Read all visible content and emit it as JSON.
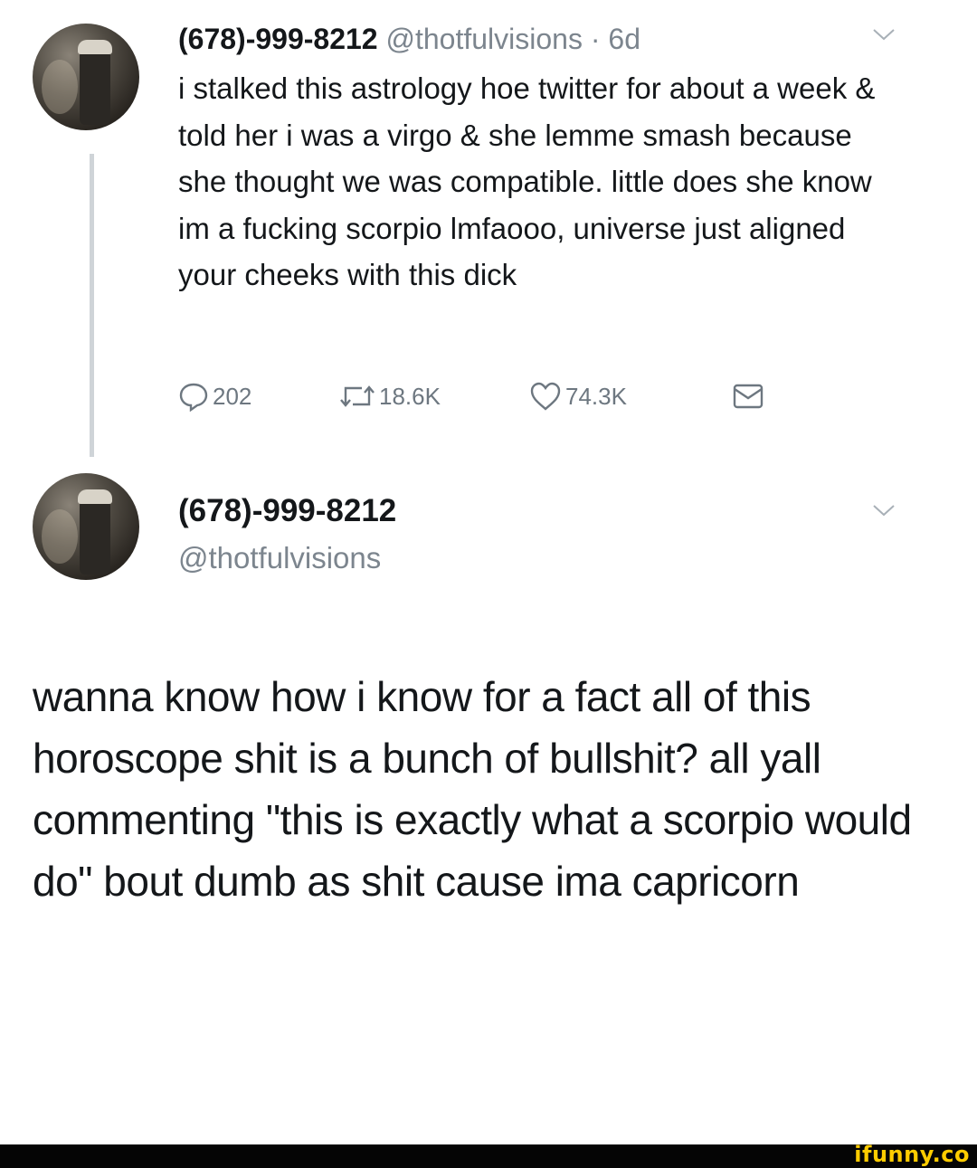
{
  "tweet": {
    "display_name": "(678)-999-8212",
    "handle": "@thotfulvisions",
    "time": "6d",
    "separator": " · ",
    "text": "i stalked this astrology hoe twitter for about a week & told her i was a virgo & she lemme smash because she thought we was compatible. little does she know im a fucking scorpio lmfaooo, universe just aligned your cheeks with this dick",
    "actions": {
      "replies": "202",
      "retweets": "18.6K",
      "likes": "74.3K"
    }
  },
  "reply": {
    "display_name": "(678)-999-8212",
    "handle": "@thotfulvisions",
    "text": "wanna know how i know for a fact all of this horoscope shit is a bunch of bullshit? all yall commenting \"this is exactly what a scorpio would do\" bout dumb as shit cause ima capricorn"
  },
  "watermark": "ifunny.co",
  "icons": [
    "reply-icon",
    "retweet-icon",
    "like-icon",
    "direct-message-icon",
    "chevron-down-icon"
  ],
  "colors": {
    "text": "#14171a",
    "secondary": "#7c858e",
    "thread_line": "#cfd4d8",
    "watermark": "#ffcc00"
  }
}
